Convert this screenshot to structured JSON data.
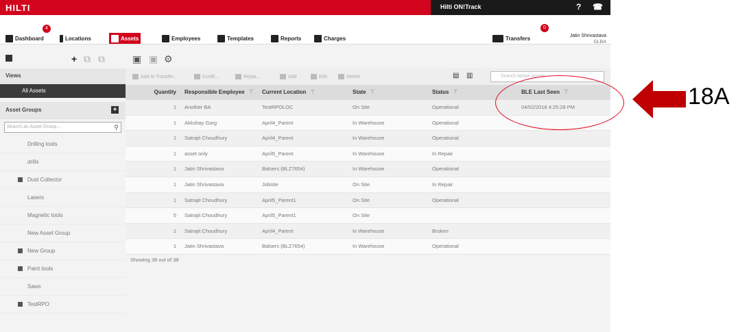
{
  "topbar": {
    "logo": "HILTI",
    "product": "Hilti ON!Track",
    "help": "?",
    "phone": "☎"
  },
  "nav": {
    "dashboard": "Dashboard",
    "dashboard_badge": "4",
    "locations": "Locations",
    "assets": "Assets",
    "employees": "Employees",
    "templates": "Templates",
    "reports": "Reports",
    "charges": "Charges",
    "transfers": "Transfers",
    "transfers_badge": "0",
    "user_name": "Jatin Shrivastava",
    "user_org": "GLBA"
  },
  "sidebar": {
    "views_header": "Views",
    "selected_view": "All Assets",
    "groups_header": "Asset Groups",
    "group_search_placeholder": "Search an Asset Group...",
    "groups": [
      {
        "label": "Drilling tools",
        "expand": false
      },
      {
        "label": "drills",
        "expand": false
      },
      {
        "label": "Dust Collector",
        "expand": true
      },
      {
        "label": "Lasers",
        "expand": false
      },
      {
        "label": "Magnetic tools",
        "expand": false
      },
      {
        "label": "New Asset Group",
        "expand": false
      },
      {
        "label": "New Group",
        "expand": true
      },
      {
        "label": "Paint tools",
        "expand": true
      },
      {
        "label": "Saws",
        "expand": false
      },
      {
        "label": "TestRPO",
        "expand": true
      }
    ]
  },
  "actions": {
    "add_to_transfer": "Add to Transfer...",
    "confirm": "Confir...",
    "repair": "Repai...",
    "add": "Add",
    "edit": "Edit",
    "delete": "Delete",
    "search_placeholder": "Search below assets"
  },
  "table": {
    "columns": [
      "Quantity",
      "Responsible Employee",
      "Current Location",
      "State",
      "Status",
      "BLE Last Seen"
    ],
    "rows": [
      [
        "1",
        "Another BA",
        "TestRPOLOC",
        "On Site",
        "Operational",
        "04/02/2018 4:25:28 PM"
      ],
      [
        "1",
        "Akkshay Garg",
        "April4_Parent",
        "In Warehouse",
        "Operational",
        ""
      ],
      [
        "1",
        "Satrajit Choudhury",
        "April4_Parent",
        "In Warehouse",
        "Operational",
        ""
      ],
      [
        "1",
        "asset only",
        "April5_Parent",
        "In Warehouse",
        "In Repair",
        ""
      ],
      [
        "1",
        "Jatin Shrivastava",
        "Balsers (BLZ7654)",
        "In Warehouse",
        "Operational",
        ""
      ],
      [
        "1",
        "Jatin Shrivastava",
        "Jobsite",
        "On Site",
        "In Repair",
        ""
      ],
      [
        "1",
        "Satrajit Choudhury",
        "April5_Parent1",
        "On Site",
        "Operational",
        ""
      ],
      [
        "5",
        "Satrajit Choudhury",
        "April5_Parent1",
        "On Site",
        "",
        ""
      ],
      [
        "1",
        "Satrajit Choudhury",
        "April4_Parent",
        "In Warehouse",
        "Broken",
        ""
      ],
      [
        "1",
        "Jatin Shrivastava",
        "Balsers (BLZ7654)",
        "In Warehouse",
        "Operational",
        ""
      ]
    ],
    "footer": "Showing 38 out of 38"
  },
  "annotation": {
    "label": "18A",
    "color": "#c00000"
  }
}
